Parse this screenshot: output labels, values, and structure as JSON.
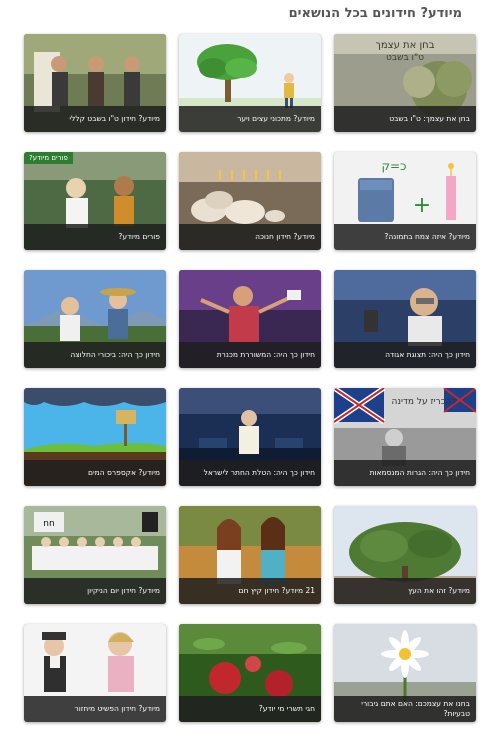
{
  "heading": "מיודע? חידונים בכל הנושאים",
  "cards": [
    {
      "caption": "בחן את עצמך: ט\"ו בשבט",
      "overlay_text": "בחן את עצמך\nט\"ו בשבט"
    },
    {
      "caption": "מיודע? מתכוני עצים ויער"
    },
    {
      "caption": "מיודע? חידון ט\"ו בשבט קללי"
    },
    {
      "caption": "מיודע? איזה צמח בתמונה?",
      "overlay_text": "כ=ק"
    },
    {
      "caption": "מיודע? חידון חנוכה"
    },
    {
      "caption": "פורים מיודע?",
      "badge": "פורים מיודע?"
    },
    {
      "caption": "חידון כך היה: תצוגת אגודה"
    },
    {
      "caption": "חידון כך היה: המשוררת מכנרת"
    },
    {
      "caption": "חידון כך היה: ביכורי החלוצה"
    },
    {
      "caption": "חידון כך היה: הגרות המנסמאות",
      "overlay_text": "להכריז על מדינה"
    },
    {
      "caption": "חידון כך היה: הטלת החתר לישראל"
    },
    {
      "caption": "מיודע? אקספרס המים"
    },
    {
      "caption": "מיודע? זהו את העץ"
    },
    {
      "caption": "21 מיודע? חידון קיץ חם"
    },
    {
      "caption": "מיודע? חידון יום הניקיון"
    },
    {
      "caption": "בחנו את עצמכם: האם אתם גיבורי טבעיות?"
    },
    {
      "caption": "חגי תשרי מי יודע?"
    },
    {
      "caption": "מיודע? חידון הפשיט מיחזור"
    }
  ]
}
